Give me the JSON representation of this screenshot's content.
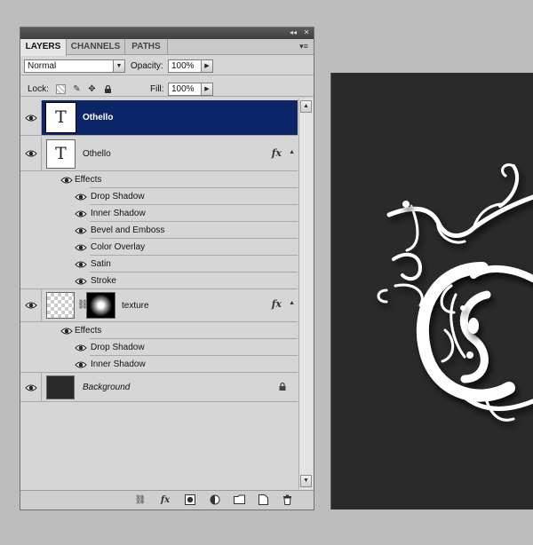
{
  "tabs": [
    {
      "label": "LAYERS",
      "active": true
    },
    {
      "label": "CHANNELS",
      "active": false
    },
    {
      "label": "PATHS",
      "active": false
    }
  ],
  "options": {
    "blend_mode": "Normal",
    "opacity_label": "Opacity:",
    "opacity_value": "100%",
    "lock_label": "Lock:",
    "fill_label": "Fill:",
    "fill_value": "100%"
  },
  "layers": [
    {
      "name": "Othello",
      "kind": "text",
      "selected": true,
      "thumb": "T"
    },
    {
      "name": "Othello",
      "kind": "text",
      "selected": false,
      "thumb": "T",
      "fx": "fx",
      "effects_label": "Effects",
      "effects": [
        "Drop Shadow",
        "Inner Shadow",
        "Bevel and Emboss",
        "Color Overlay",
        "Satin",
        "Stroke"
      ]
    },
    {
      "name": "texture",
      "kind": "masked",
      "selected": false,
      "fx": "fx",
      "effects_label": "Effects",
      "effects": [
        "Drop Shadow",
        "Inner Shadow"
      ]
    },
    {
      "name": "Background",
      "kind": "background",
      "selected": false,
      "locked": true
    }
  ],
  "icons": {
    "visibility": "eye-icon",
    "lock_transparent": "lock-transparent-icon",
    "lock_image": "lock-image-icon",
    "lock_position": "lock-position-icon",
    "lock_all": "lock-all-icon",
    "bottom": [
      "link-layers-icon",
      "fx-icon",
      "add-mask-icon",
      "adjustment-layer-icon",
      "new-group-icon",
      "new-layer-icon",
      "delete-layer-icon"
    ]
  },
  "colors": {
    "selection": "#0c2567",
    "canvas": "#2a2a2a"
  }
}
